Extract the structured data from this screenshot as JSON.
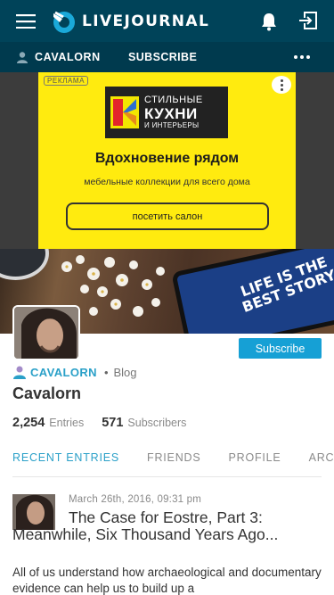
{
  "app": {
    "logo_text": "LIVEJOURNAL",
    "colors": {
      "topbar": "#004359",
      "subbar": "#003a4e",
      "accent": "#2aa0c8",
      "subscribe": "#16a0d5"
    }
  },
  "topbar": {
    "icons": [
      "menu-icon",
      "livejournal-logo-icon",
      "bell-icon",
      "login-icon"
    ]
  },
  "subbar": {
    "user": "CAVALORN",
    "subscribe": "SUBSCRIBE"
  },
  "ad": {
    "tag": "РЕКЛАМА",
    "brand_line1": "СТИЛЬНЫЕ",
    "brand_line2": "КУХНИ",
    "brand_line3": "И ИНТЕРЬЕРЫ",
    "headline": "Вдохновение рядом",
    "subline": "мебельные коллекции для всего дома",
    "cta": "посетить салон"
  },
  "cover": {
    "phone_text": "LIFE IS THE BEST STORY"
  },
  "profile": {
    "subscribe_button": "Subscribe",
    "username": "CAVALORN",
    "separator": "•",
    "type": "Blog",
    "title": "Cavalorn",
    "entries_count": "2,254",
    "entries_label": "Entries",
    "subscribers_count": "571",
    "subscribers_label": "Subscribers"
  },
  "tabs": [
    {
      "label": "RECENT ENTRIES",
      "active": true
    },
    {
      "label": "FRIENDS",
      "active": false
    },
    {
      "label": "PROFILE",
      "active": false
    },
    {
      "label": "ARC",
      "active": false
    }
  ],
  "entry": {
    "date": "March 26th, 2016, 09:31 pm",
    "title": "The Case for Eostre, Part 3: Meanwhile, Six Thousand Years Ago...",
    "body": "All of us understand how archaeological and documentary evidence can help us to build up a"
  }
}
